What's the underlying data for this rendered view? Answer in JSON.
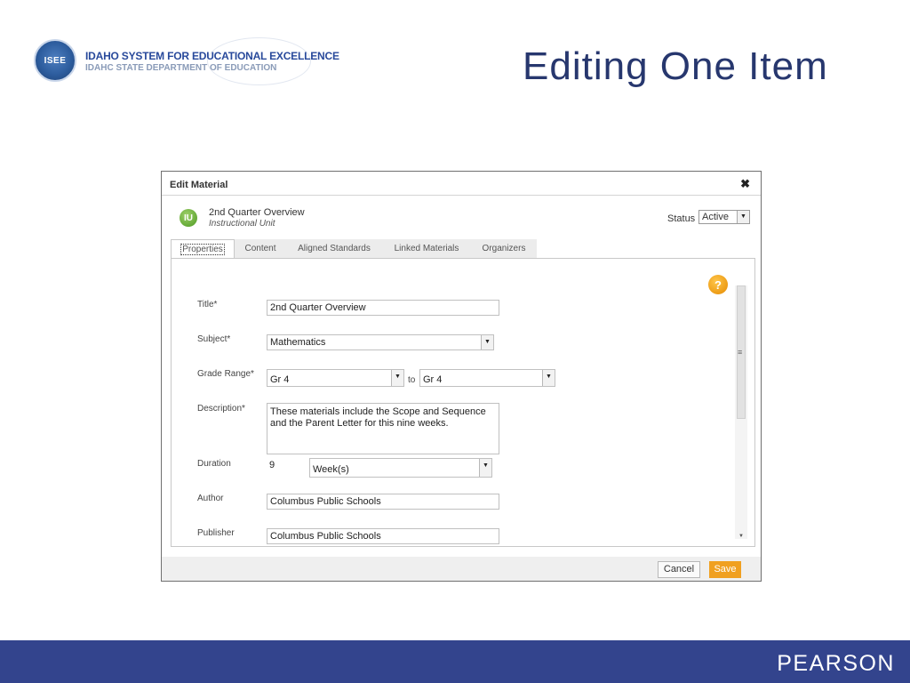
{
  "logo": {
    "seal_text": "ISEE",
    "line1": "IDAHO SYSTEM FOR EDUCATIONAL EXCELLENCE",
    "line2": "IDAHC STATE DEPARTMENT OF EDUCATION"
  },
  "slide_title": "Editing One Item",
  "dialog": {
    "title": "Edit Material",
    "close_icon": "✖",
    "item": {
      "icon_text": "IU",
      "name": "2nd Quarter Overview",
      "type": "Instructional Unit"
    },
    "status": {
      "label": "Status",
      "value": "Active"
    },
    "tabs": [
      "Properties",
      "Content",
      "Aligned Standards",
      "Linked Materials",
      "Organizers"
    ],
    "help_icon": "?",
    "form": {
      "title_label": "Title*",
      "title_value": "2nd Quarter Overview",
      "subject_label": "Subject*",
      "subject_value": "Mathematics",
      "grade_label": "Grade Range*",
      "grade_from": "Gr 4",
      "grade_to_label": "to",
      "grade_to": "Gr 4",
      "description_label": "Description*",
      "description_value": "These materials include the Scope and Sequence and the Parent Letter for this nine weeks.",
      "duration_label": "Duration",
      "duration_number": "9",
      "duration_unit": "Week(s)",
      "author_label": "Author",
      "author_value": "Columbus Public Schools",
      "publisher_label": "Publisher",
      "publisher_value": "Columbus Public Schools"
    },
    "buttons": {
      "cancel": "Cancel",
      "save": "Save"
    }
  },
  "footer": {
    "brand": "PEARSON"
  },
  "colors": {
    "title": "#27376e",
    "footer_bar": "#33448d",
    "save_button": "#f0a020"
  }
}
